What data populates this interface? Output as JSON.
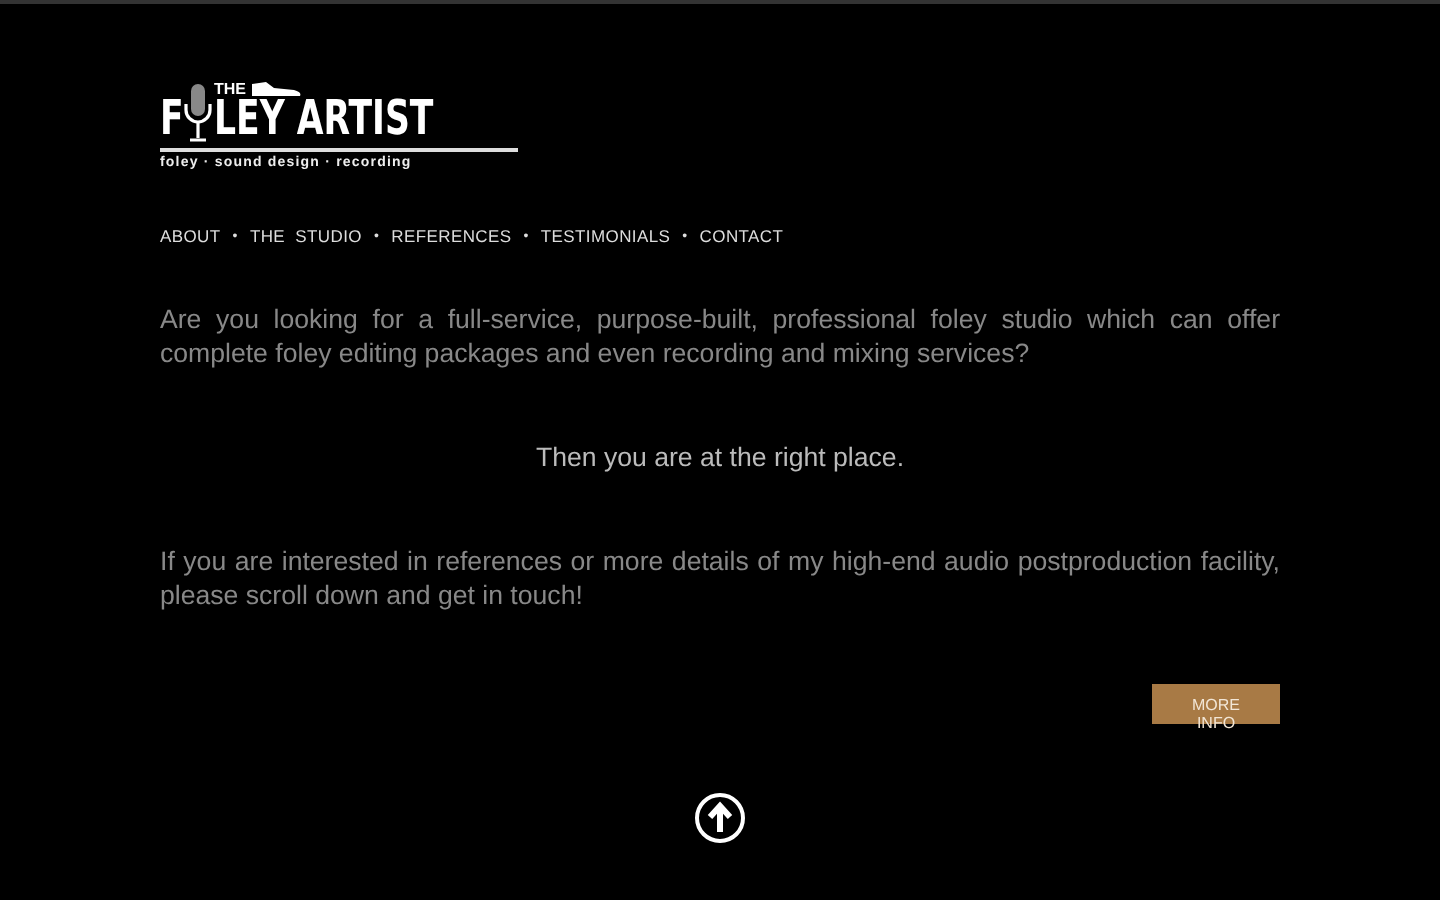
{
  "logo": {
    "lead": "F",
    "small": "THE",
    "rest": "LEY ARTIST",
    "tagline": "foley · sound design · recording"
  },
  "nav": {
    "separator": "•",
    "items": [
      {
        "label": "ABOUT"
      },
      {
        "label": "THE  STUDIO"
      },
      {
        "label": "REFERENCES"
      },
      {
        "label": "TESTIMONIALS"
      },
      {
        "label": "CONTACT"
      }
    ]
  },
  "intro": "Are you looking for a full-service, purpose-built, professional foley studio which can offer complete foley editing packages and even recording and mixing services?",
  "tagline": "Then you are at the right place.",
  "details": "If you are interested in references or more details of my high-end audio postproduction facility, please scroll down and get in touch!",
  "button": "MORE INFO"
}
